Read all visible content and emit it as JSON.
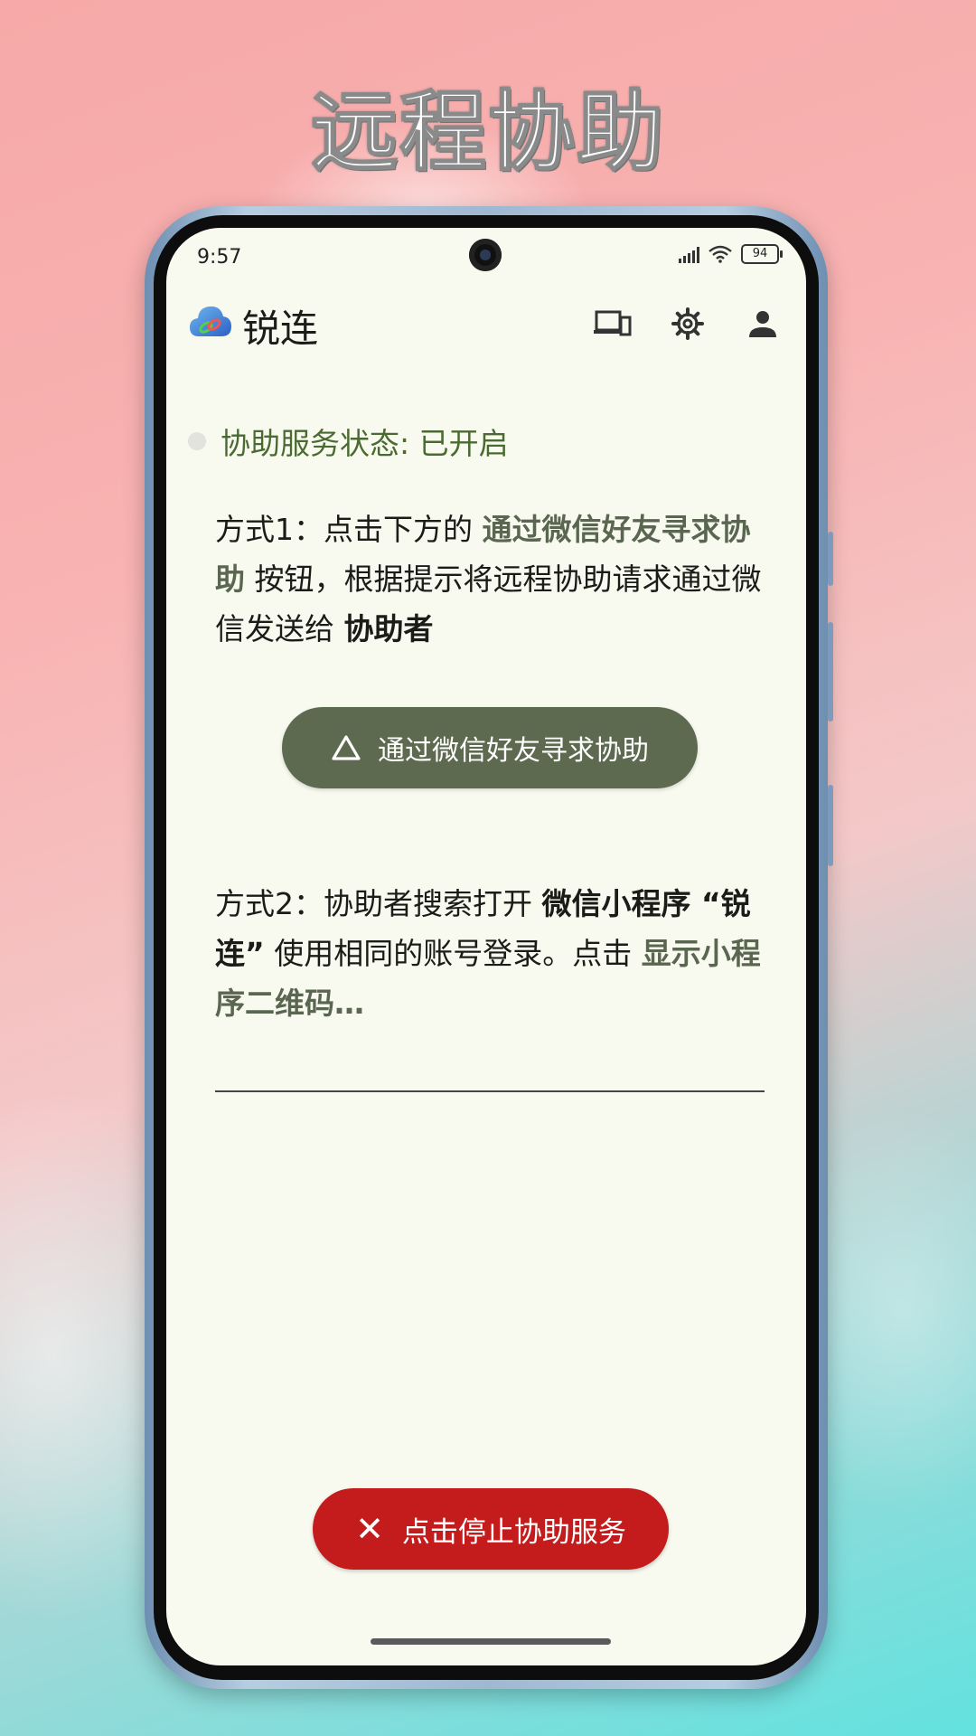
{
  "hero": {
    "title": "远程协助"
  },
  "status_bar": {
    "time": "9:57",
    "battery": "94"
  },
  "app_bar": {
    "title": "锐连",
    "icons": [
      "devices-icon",
      "gear-icon",
      "person-icon"
    ]
  },
  "service": {
    "status_text": "协助服务状态: 已开启"
  },
  "method1": {
    "prefix": "方式1：点击下方的 ",
    "highlight": "通过微信好友寻求协助",
    "middle": " 按钮，根据提示将远程协助请求通过微信发送给 ",
    "strong": "协助者"
  },
  "wechat_button": {
    "label": "通过微信好友寻求协助"
  },
  "method2": {
    "prefix": "方式2：协助者搜索打开 ",
    "strong1": "微信小程序 “锐连”",
    "middle": " 使用相同的账号登录。点击 ",
    "highlight": "显示小程序二维码…"
  },
  "stop_button": {
    "label": "点击停止协助服务"
  },
  "colors": {
    "primary": "#5d6a4f",
    "danger": "#c41c1c",
    "status_green": "#4b6a32",
    "surface": "#f8faf0"
  }
}
